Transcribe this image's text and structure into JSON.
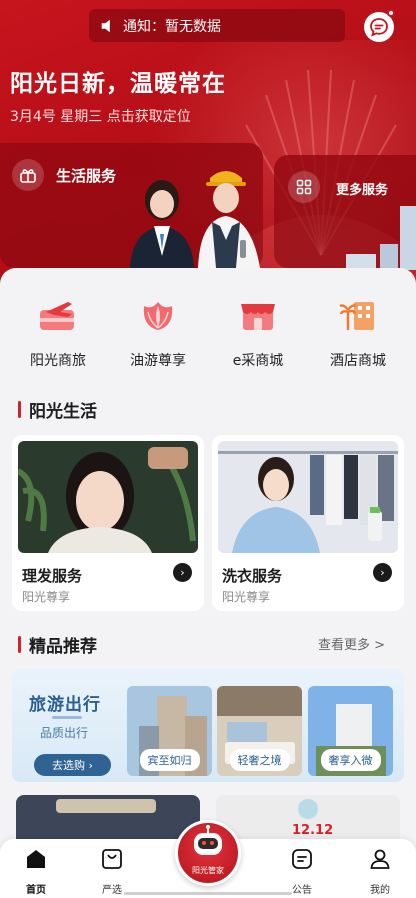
{
  "header": {
    "notice": "通知：暂无数据",
    "slogan": "阳光日新，温暖常在",
    "dateline": "3月4号 星期三 点击获取定位"
  },
  "services": {
    "life": {
      "label": "生活服务",
      "icon": "gift-icon"
    },
    "more": {
      "label": "更多服务",
      "icon": "grid-icon"
    }
  },
  "quick_links": [
    {
      "label": "阳光商旅",
      "icon": "airplane-icon"
    },
    {
      "label": "油游尊享",
      "icon": "lotus-icon"
    },
    {
      "label": "e采商城",
      "icon": "shop-icon"
    },
    {
      "label": "酒店商城",
      "icon": "hotel-icon"
    }
  ],
  "sunshine_life": {
    "title": "阳光生活",
    "cards": [
      {
        "title": "理发服务",
        "subtitle": "阳光尊享"
      },
      {
        "title": "洗衣服务",
        "subtitle": "阳光尊享"
      }
    ]
  },
  "recommend": {
    "title": "精品推荐",
    "see_more": "查看更多 >",
    "travel": {
      "title": "旅游出行",
      "subtitle": "品质出行",
      "button": "去选购 ›",
      "pics": [
        "宾至如归",
        "轻奢之境",
        "奢享入微"
      ]
    },
    "peek_badge": "12.12"
  },
  "tabbar": {
    "items": [
      "首页",
      "严选",
      "公告",
      "我的"
    ],
    "robot_label": "阳光管家"
  },
  "colors": {
    "brand_red": "#c8141d",
    "travel_blue": "#2f6393"
  }
}
